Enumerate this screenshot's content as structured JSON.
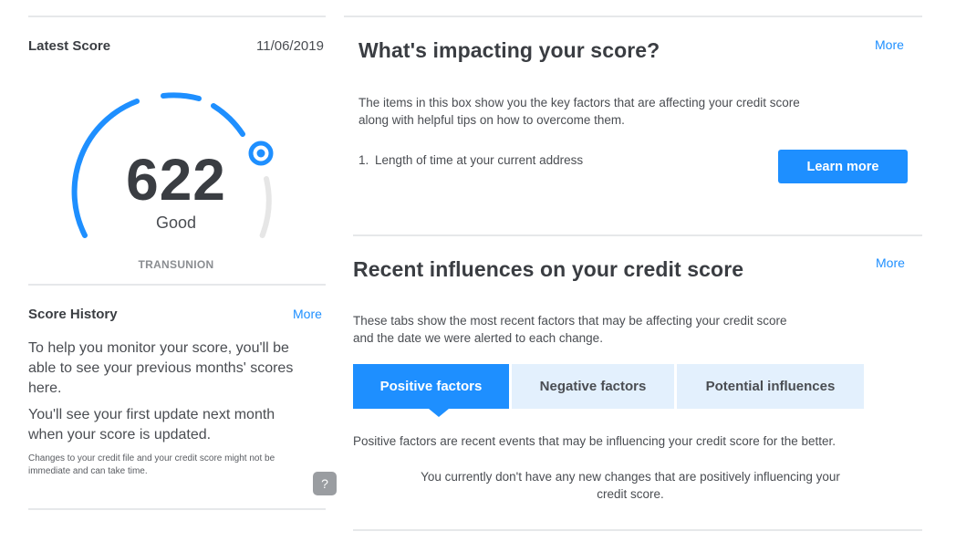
{
  "latest_score": {
    "title": "Latest Score",
    "date": "11/06/2019",
    "score": "622",
    "rating": "Good",
    "bureau": "TRANSUNION"
  },
  "score_history": {
    "title": "Score History",
    "more_label": "More",
    "para1": "To help you monitor your score, you'll be able to see your previous months' scores here.",
    "para2": "You'll see your first update next month when your score is updated.",
    "footnote": "Changes to your credit file and your credit score might not be immediate and can take time.",
    "help_label": "?"
  },
  "impacting": {
    "title": "What's impacting your score?",
    "more_label": "More",
    "description": "The items in this box show you the key factors that are affecting your credit score along with helpful tips on how to overcome them.",
    "item_number": "1.",
    "item_text": "Length of time at your current address",
    "learn_more_label": "Learn more"
  },
  "influences": {
    "title": "Recent influences on your credit score",
    "more_label": "More",
    "description": "These tabs show the most recent factors that may be affecting your credit score and the date we were alerted to each change.",
    "tabs": [
      {
        "label": "Positive factors",
        "active": true
      },
      {
        "label": "Negative factors",
        "active": false
      },
      {
        "label": "Potential influences",
        "active": false
      }
    ],
    "tab_description": "Positive factors are recent events that may be influencing your credit score for the better.",
    "empty_message": "You currently don't have any new changes that are positively influencing your credit score."
  },
  "colors": {
    "accent": "#1e8fff",
    "tab_inactive": "#e3f0fd",
    "gauge_track": "#e6e6e6",
    "text": "#3a3d42"
  }
}
